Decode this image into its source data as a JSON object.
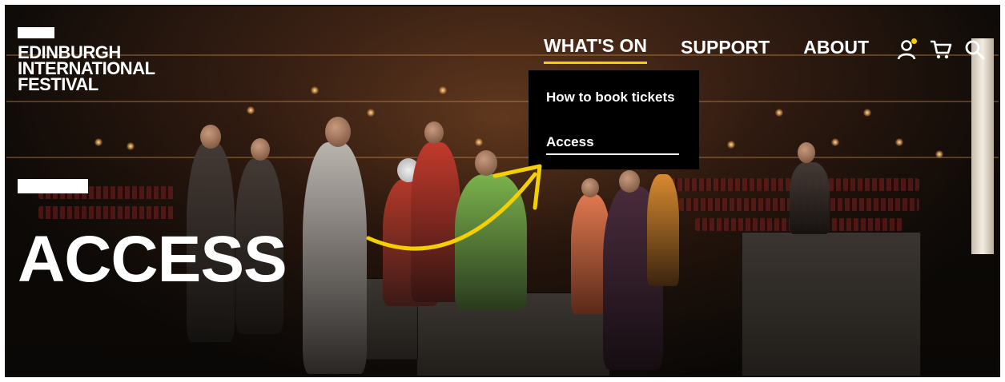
{
  "logo": {
    "lines": [
      "EDINBURGH",
      "INTERNATIONAL",
      "FESTIVAL"
    ]
  },
  "nav": {
    "items": [
      {
        "label": "WHAT'S ON",
        "active": true
      },
      {
        "label": "SUPPORT",
        "active": false
      },
      {
        "label": "ABOUT",
        "active": false
      }
    ],
    "icons": [
      "account-icon",
      "cart-icon",
      "search-icon"
    ]
  },
  "dropdown": {
    "items": [
      {
        "label": "How to book tickets"
      },
      {
        "label": "Access"
      }
    ]
  },
  "hero": {
    "title": "ACCESS"
  },
  "colors": {
    "accent": "#f5d000",
    "annotation_arrow": "#f5d000",
    "text": "#ffffff",
    "dropdown_bg": "#000000"
  }
}
